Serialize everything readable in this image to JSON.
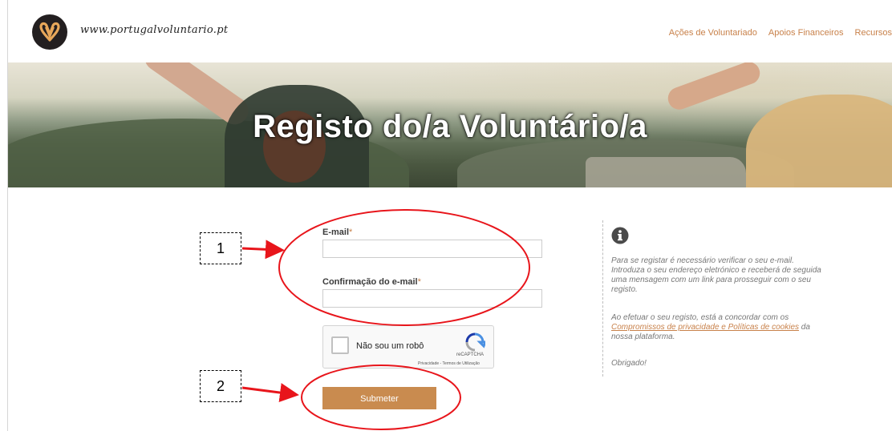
{
  "header": {
    "site_url": "www.portugalvoluntario.pt",
    "nav": [
      "Ações de Voluntariado",
      "Apoios Financeiros",
      "Recursos"
    ],
    "accent": "#c8814a"
  },
  "hero": {
    "title": "Registo do/a Voluntário/a"
  },
  "form": {
    "email_label": "E-mail",
    "email_confirm_label": "Confirmação do e-mail",
    "required_mark": "*",
    "email_value": "",
    "email_confirm_value": "",
    "captcha": {
      "label": "Não sou um robô",
      "brand": "reCAPTCHA",
      "links": "Privacidade - Termos de Utilização"
    },
    "submit_label": "Submeter",
    "submit_color": "#c98b4f"
  },
  "info": {
    "icon": "info-icon",
    "p1": "Para se registar é necessário verificar o seu e-mail. Introduza o seu endereço eletrónico e receberá de seguida uma mensagem com um link para prosseguir com o seu registo.",
    "p2_before": "Ao efetuar o seu registo, está a concordar com os ",
    "p2_link": "Compromissos de privacidade e Políticas de cookies",
    "p2_after": " da nossa plataforma.",
    "p3": "Obrigado!"
  },
  "annotations": {
    "box1": "1",
    "box2": "2",
    "highlight_color": "#e8151b"
  }
}
